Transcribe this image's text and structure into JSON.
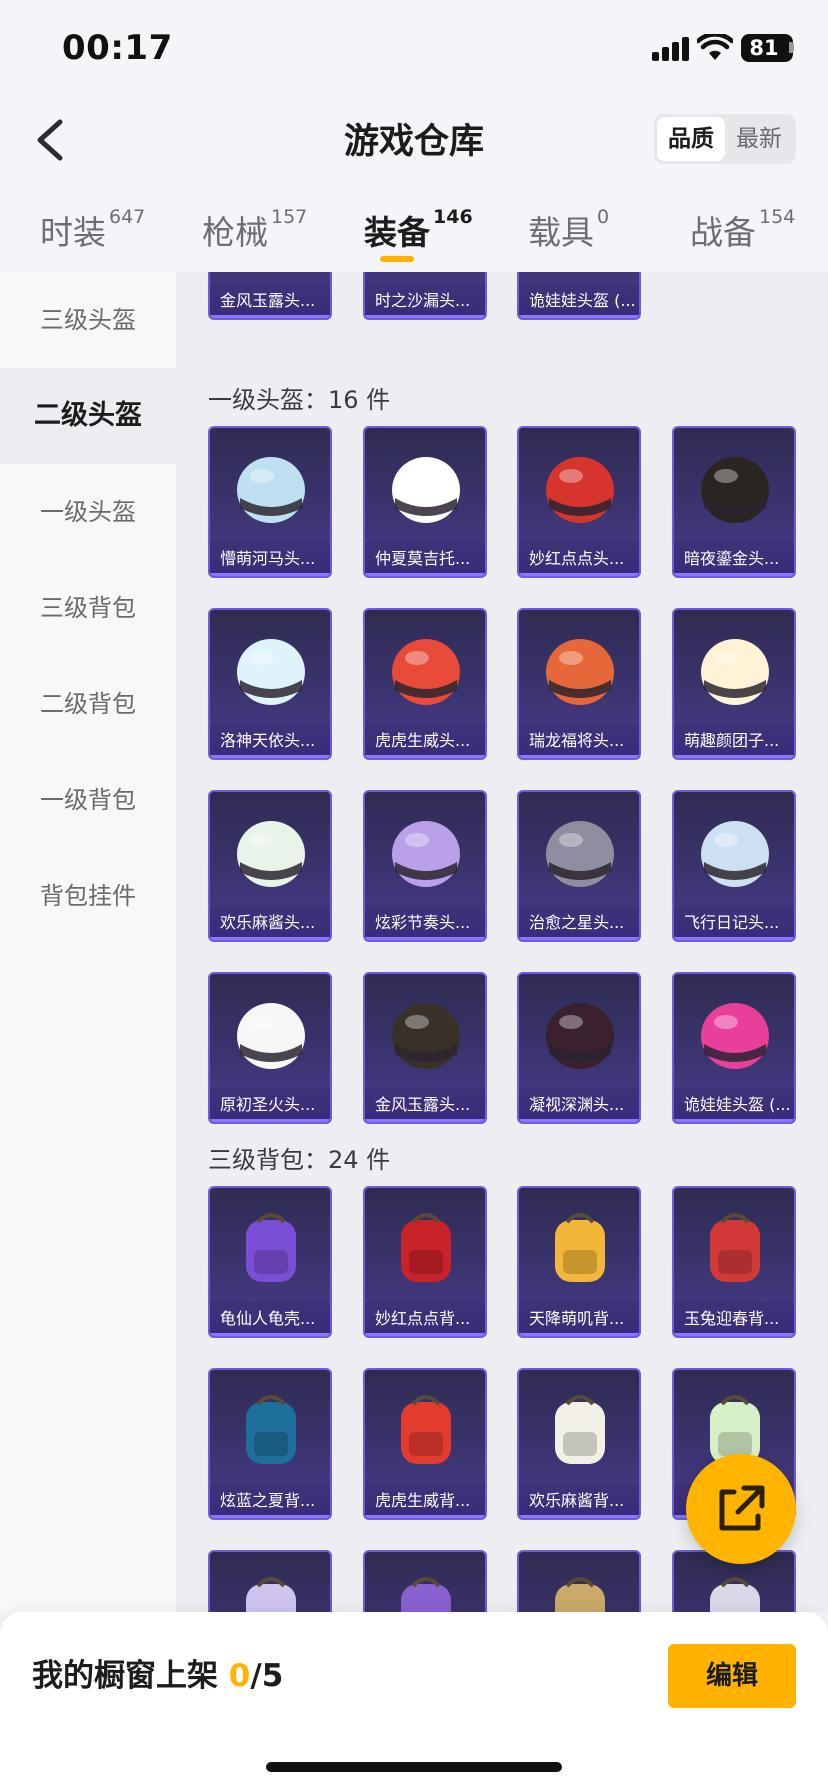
{
  "status_bar": {
    "time": "00:17",
    "battery": "81"
  },
  "header": {
    "title": "游戏仓库",
    "sort_options": [
      "品质",
      "最新"
    ],
    "sort_active": "品质"
  },
  "tabs": [
    {
      "label": "时装",
      "count": "647"
    },
    {
      "label": "枪械",
      "count": "157"
    },
    {
      "label": "装备",
      "count": "146"
    },
    {
      "label": "载具",
      "count": "0"
    },
    {
      "label": "战备",
      "count": "154"
    }
  ],
  "sidebar": {
    "items": [
      "三级头盔",
      "二级头盔",
      "一级头盔",
      "三级背包",
      "二级背包",
      "一级背包",
      "背包挂件"
    ],
    "active": "二级头盔"
  },
  "sections": {
    "prev_helmet_items": [
      "金风玉露头...",
      "时之沙漏头...",
      "诡娃娃头盔 (..."
    ],
    "lvl1_helmet_title": "一级头盔：16 件",
    "lvl1_helmet_items": [
      "懵萌河马头...",
      "仲夏莫吉托...",
      "妙红点点头...",
      "暗夜鎏金头...",
      "洛神天依头...",
      "虎虎生威头...",
      "瑞龙福将头...",
      "萌趣颜团子...",
      "欢乐麻酱头...",
      "炫彩节奏头...",
      "治愈之星头...",
      "飞行日记头...",
      "原初圣火头...",
      "金风玉露头...",
      "凝视深渊头...",
      "诡娃娃头盔 (..."
    ],
    "lvl3_backpack_title": "三级背包：24 件",
    "lvl3_backpack_items": [
      "龟仙人龟壳...",
      "妙红点点背...",
      "天降萌叽背...",
      "玉兔迎春背...",
      "炫蓝之夏背...",
      "虎虎生威背...",
      "欢乐麻酱背...",
      "",
      "",
      "",
      "",
      ""
    ]
  },
  "bottom_bar": {
    "label": "我的橱窗上架",
    "count": "0",
    "separator": "/",
    "max": "5",
    "edit_label": "编辑"
  },
  "colors": {
    "accent": "#ffb300",
    "card_border": "#6f5be3",
    "card_bg": "#3b3470"
  }
}
